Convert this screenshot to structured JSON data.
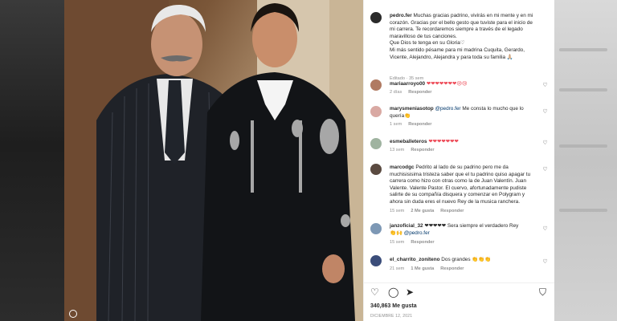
{
  "post": {
    "author": "pedro.fer",
    "caption_line1": "Muchas gracias padrino, vivirás en mi mente y en mi",
    "caption_line2": "corazón. Gracias por el bello gesto que tuviste para el inicio de",
    "caption_line3": "mi carrera. Te recordaremos siempre a través de el legado",
    "caption_line4": "maravilloso de tus canciones.",
    "caption_line5": "Que Dios te tenga en su Gloria♡",
    "caption_line6": "Mi más sentido pésame para mi madrina Cuquita, Gerardo,",
    "caption_line7": "Vicente, Alejandro, Alejandra y para toda su familia 🙏🏼",
    "edited": "Editado · 35 sem"
  },
  "comments": [
    {
      "user": "mariaarroyo00",
      "text": "❤❤❤❤❤❤❤😢😢",
      "time": "2 días",
      "reply": "Responder"
    },
    {
      "user": "marysmeniasotop",
      "mention": "@pedro.fer",
      "text1": "Me consta lo mucho que lo",
      "text2": "quería👏",
      "time": "1 sem",
      "reply": "Responder"
    },
    {
      "user": "esmeballeteros",
      "text": "❤❤❤❤❤❤❤",
      "time": "13 sem",
      "reply": "Responder"
    },
    {
      "user": "marcodgc",
      "line1": "Pedrito al lado de su padrino pero me da",
      "line2": "muchisisisima tristeza saber que el tu padrino quiso apagar tu",
      "line3": "carrera como hizo con otras como la de Juan Valentín. Juan",
      "line4": "Valente. Valente Pastor. El cuervo, afortunadamente pudiste",
      "line5": "salirte de su compañía disquera y comenzar en Polygram y",
      "line6": "ahora sin duda eres el nuevo Rey de la musica ranchera.",
      "time": "15 sem",
      "likes": "2 Me gusta",
      "reply": "Responder"
    },
    {
      "user": "janzoficial_32",
      "text1": "❤❤❤❤❤ Sera siempre el verdadero Rey",
      "text2": "👏🙌",
      "mention": "@pedro.fer",
      "time": "15 sem",
      "reply": "Responder"
    },
    {
      "user": "el_charrito_zoniteno",
      "text": "Dos grandes 👏👏👏",
      "time": "21 sem",
      "likes": "1 Me gusta",
      "reply": "Responder"
    }
  ],
  "footer": {
    "likes": "340,863 Me gusta",
    "date": "DICIEMBRE 12, 2021"
  },
  "icons": {
    "like": "heart-icon",
    "comment": "comment-icon",
    "share": "share-icon",
    "save": "bookmark-icon"
  },
  "colors": {
    "muted": "#8e8e8e",
    "mention": "#00376b",
    "heart": "#ed4956"
  }
}
